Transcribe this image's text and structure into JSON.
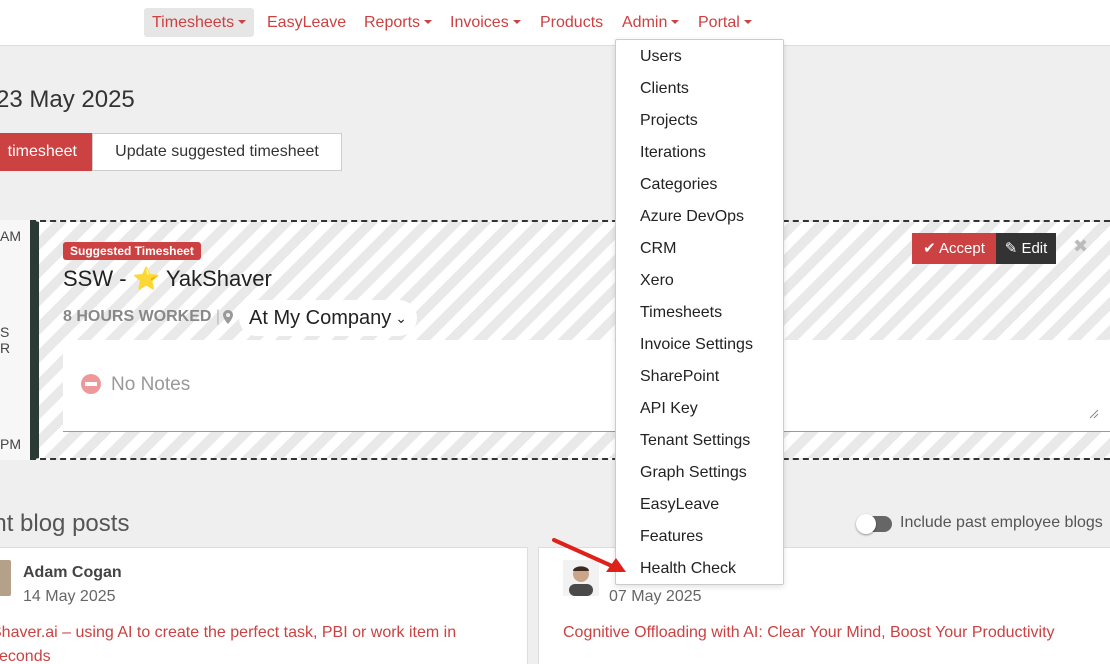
{
  "nav": {
    "items": [
      {
        "label": "Timesheets",
        "dropdown": true,
        "active": true
      },
      {
        "label": "EasyLeave",
        "dropdown": false
      },
      {
        "label": "Reports",
        "dropdown": true
      },
      {
        "label": "Invoices",
        "dropdown": true
      },
      {
        "label": "Products",
        "dropdown": false
      },
      {
        "label": "Admin",
        "dropdown": true
      },
      {
        "label": "Portal",
        "dropdown": true
      }
    ]
  },
  "page": {
    "date_heading": "23 May 2025",
    "btn_timesheet": "timesheet",
    "btn_update": "Update suggested timesheet"
  },
  "time_labels": [
    "AM",
    "S",
    "R",
    "PM"
  ],
  "card": {
    "badge": "Suggested Timesheet",
    "title_prefix": "SSW -",
    "title_suffix": "YakShaver",
    "hours": "8 HOURS WORKED",
    "location": "At My Company",
    "notes": "No Notes",
    "accept": "Accept",
    "edit": "Edit"
  },
  "blog": {
    "heading": "ent blog posts",
    "toggle_label": "Include past employee blogs",
    "posts": [
      {
        "author": "Adam Cogan",
        "date": "14 May 2025",
        "title": "Shaver.ai – using AI to create the perfect task, PBI or work item in seconds"
      },
      {
        "author": "",
        "date": "07 May 2025",
        "title": "Cognitive Offloading with AI: Clear Your Mind, Boost Your Productivity"
      }
    ]
  },
  "admin_menu": {
    "items": [
      "Users",
      "Clients",
      "Projects",
      "Iterations",
      "Categories",
      "Azure DevOps",
      "CRM",
      "Xero",
      "Timesheets",
      "Invoice Settings",
      "SharePoint",
      "API Key",
      "Tenant Settings",
      "Graph Settings",
      "EasyLeave",
      "Features",
      "Health Check"
    ]
  },
  "colors": {
    "accent": "#cc4141",
    "dark": "#2b3a35",
    "arrow": "#e0211a"
  }
}
